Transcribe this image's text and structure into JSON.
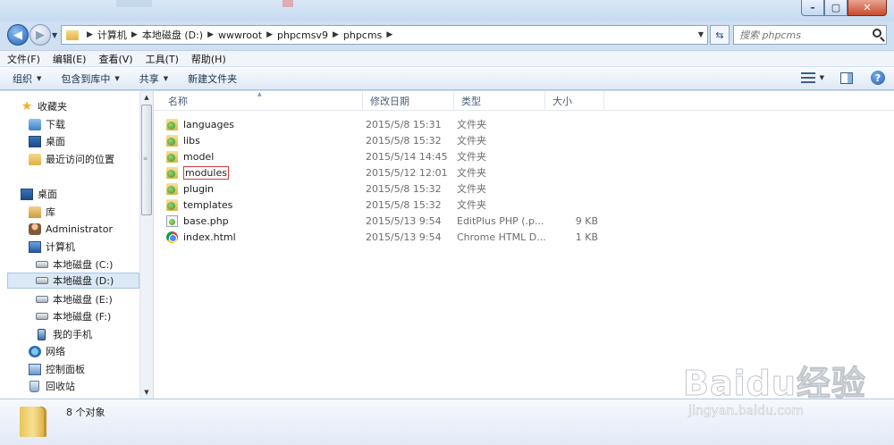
{
  "address": {
    "crumbs": [
      "计算机",
      "本地磁盘 (D:)",
      "wwwroot",
      "phpcmsv9",
      "phpcms"
    ],
    "search_placeholder": "搜索 phpcms"
  },
  "menu": [
    "文件(F)",
    "编辑(E)",
    "查看(V)",
    "工具(T)",
    "帮助(H)"
  ],
  "toolbar": {
    "organize": "组织",
    "include_in_library": "包含到库中",
    "share": "共享",
    "new_folder": "新建文件夹"
  },
  "nav_tree": [
    {
      "label": "收藏夹",
      "icon": "star-icon"
    },
    {
      "label": "下载",
      "icon": "download-icon"
    },
    {
      "label": "桌面",
      "icon": "desktop-icon"
    },
    {
      "label": "最近访问的位置",
      "icon": "recent-places-icon"
    },
    {
      "label": "桌面",
      "icon": "desktop-icon"
    },
    {
      "label": "库",
      "icon": "library-icon"
    },
    {
      "label": "Administrator",
      "icon": "user-icon"
    },
    {
      "label": "计算机",
      "icon": "computer-icon"
    },
    {
      "label": "本地磁盘 (C:)",
      "icon": "system-drive-icon"
    },
    {
      "label": "本地磁盘 (D:)",
      "icon": "drive-icon",
      "selected": true
    },
    {
      "label": "本地磁盘 (E:)",
      "icon": "drive-icon"
    },
    {
      "label": "本地磁盘 (F:)",
      "icon": "drive-icon"
    },
    {
      "label": "我的手机",
      "icon": "phone-icon"
    },
    {
      "label": "网络",
      "icon": "network-icon"
    },
    {
      "label": "控制面板",
      "icon": "control-panel-icon"
    },
    {
      "label": "回收站",
      "icon": "recycle-bin-icon"
    }
  ],
  "columns": {
    "name": "名称",
    "date": "修改日期",
    "type": "类型",
    "size": "大小"
  },
  "files": [
    {
      "name": "languages",
      "date": "2015/5/8 15:31",
      "type": "文件夹",
      "size": "",
      "icon": "folder-icon"
    },
    {
      "name": "libs",
      "date": "2015/5/8 15:32",
      "type": "文件夹",
      "size": "",
      "icon": "folder-icon"
    },
    {
      "name": "model",
      "date": "2015/5/14 14:45",
      "type": "文件夹",
      "size": "",
      "icon": "folder-icon"
    },
    {
      "name": "modules",
      "date": "2015/5/12 12:01",
      "type": "文件夹",
      "size": "",
      "icon": "folder-icon",
      "highlighted": true
    },
    {
      "name": "plugin",
      "date": "2015/5/8 15:32",
      "type": "文件夹",
      "size": "",
      "icon": "folder-icon"
    },
    {
      "name": "templates",
      "date": "2015/5/8 15:32",
      "type": "文件夹",
      "size": "",
      "icon": "folder-icon"
    },
    {
      "name": "base.php",
      "date": "2015/5/13 9:54",
      "type": "EditPlus PHP (.p...",
      "size": "9 KB",
      "icon": "php-file-icon"
    },
    {
      "name": "index.html",
      "date": "2015/5/13 9:54",
      "type": "Chrome HTML D...",
      "size": "1 KB",
      "icon": "chrome-html-icon"
    }
  ],
  "status": {
    "object_count": "8 个对象"
  },
  "watermark": {
    "logo": "Baidu经验",
    "url": "jingyan.baidu.com"
  }
}
